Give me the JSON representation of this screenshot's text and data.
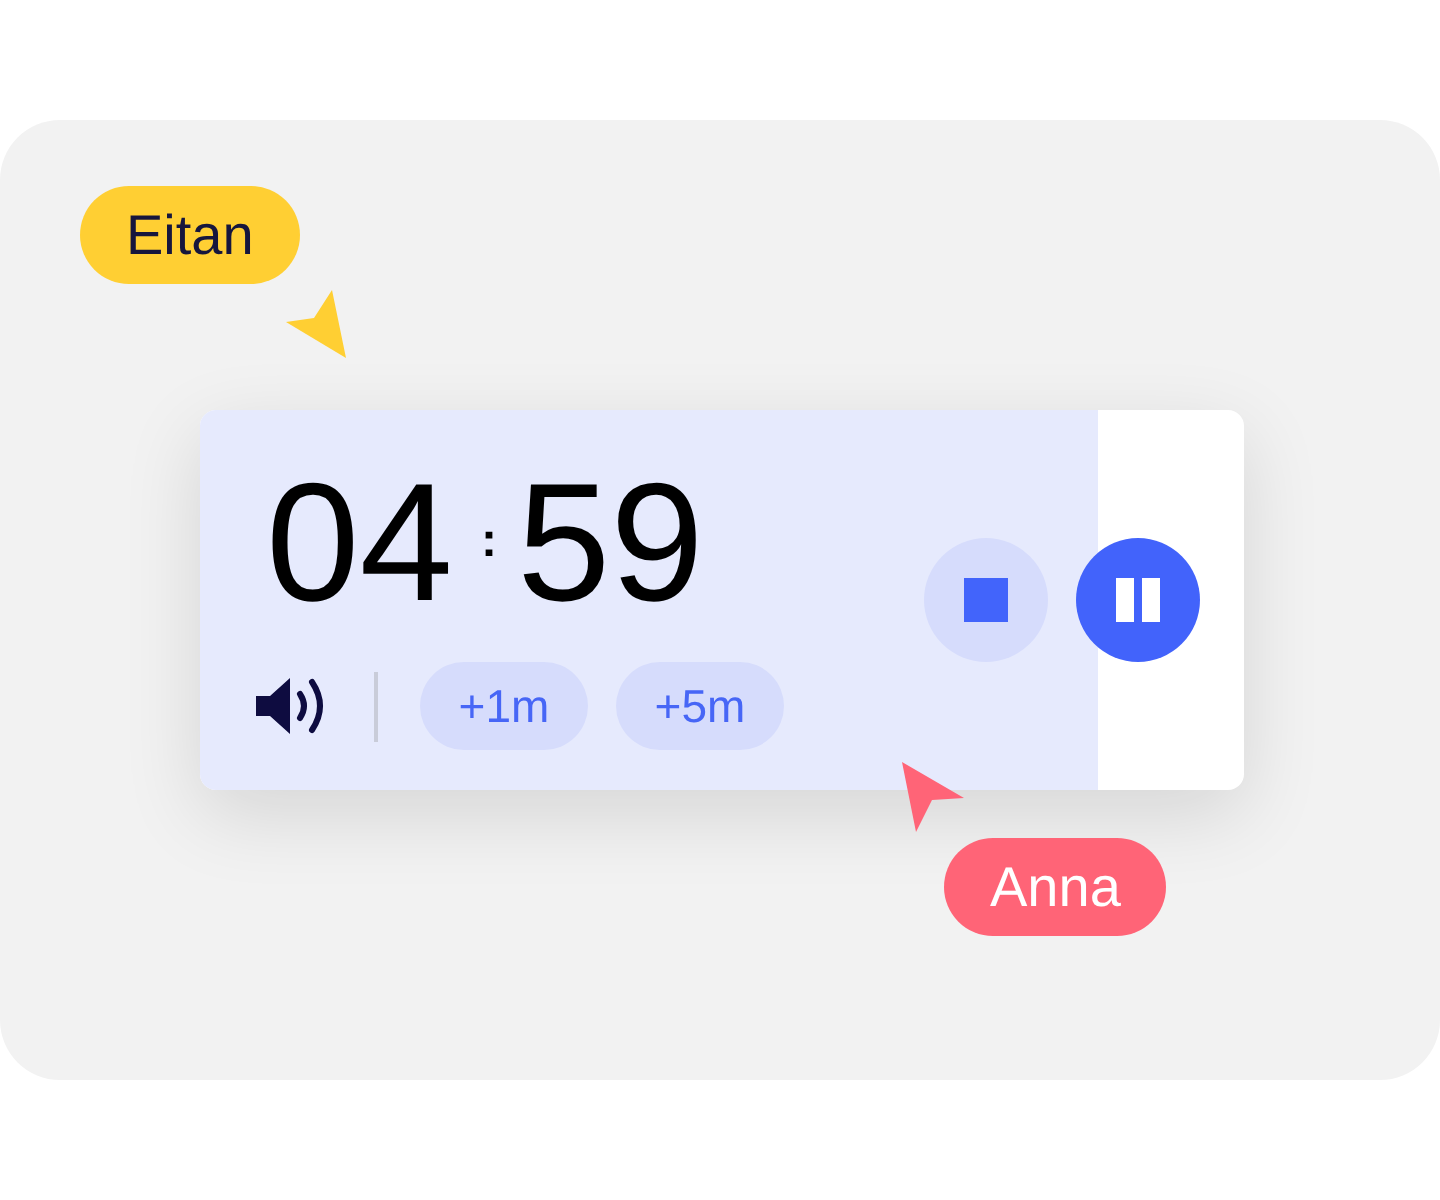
{
  "timer": {
    "minutes": "04",
    "separator": ":",
    "seconds": "59",
    "progress": {
      "level": 0.86
    },
    "running": true,
    "muted": false,
    "add_time": [
      {
        "label": "+1m"
      },
      {
        "label": "+5m"
      }
    ]
  },
  "cursors": [
    {
      "name": "Eitan",
      "color": "#ffcf33"
    },
    {
      "name": "Anna",
      "color": "#ff6477"
    }
  ]
}
